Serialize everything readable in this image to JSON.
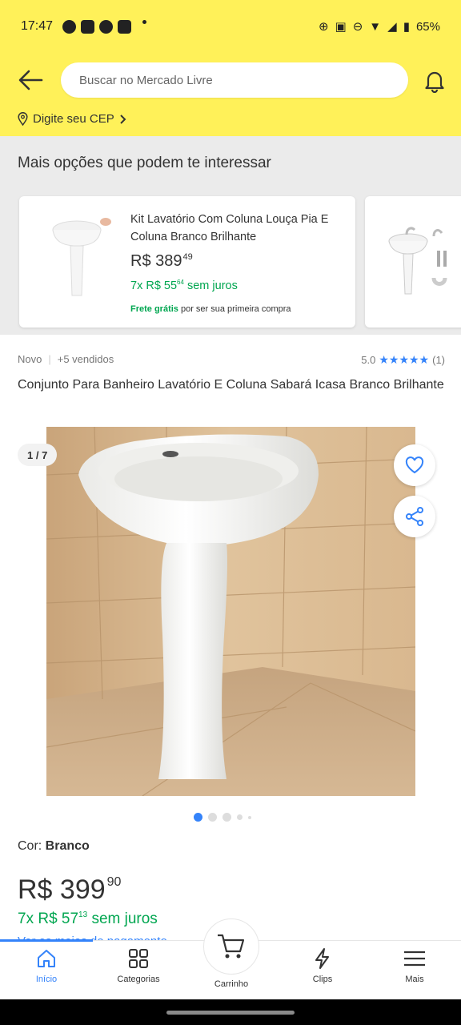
{
  "status_bar": {
    "time": "17:47",
    "battery": "65%",
    "icons_left": [
      "messenger-icon",
      "app-icon",
      "app-icon",
      "app-icon"
    ],
    "icons_right": [
      "add-circle-icon",
      "nfc-icon",
      "dnd-icon",
      "wifi-icon",
      "signal-icon",
      "battery-icon"
    ]
  },
  "header": {
    "search_placeholder": "Buscar no Mercado Livre",
    "cep_label": "Digite seu CEP",
    "brand_color": "#fff159"
  },
  "more_options": {
    "title": "Mais opções que podem te interessar",
    "card": {
      "title": "Kit Lavatório Com Coluna Louça Pia E Coluna Branco Brilhante",
      "price_int": "R$ 389",
      "price_cents": "49",
      "installments_prefix": "7x R$ 55",
      "installments_cents": "64",
      "installments_suffix": " sem juros",
      "shipping_bold": "Frete grátis",
      "shipping_rest": " por ser sua primeira compra"
    }
  },
  "product": {
    "condition": "Novo",
    "sold": "+5 vendidos",
    "rating_value": "5.0",
    "rating_count": "(1)",
    "stars": 5,
    "title": "Conjunto Para Banheiro Lavatório E Coluna Sabará  Icasa Branco Brilhante",
    "image_counter": "1 / 7",
    "color_label": "Cor: ",
    "color_value": "Branco",
    "price_int": "R$ 399",
    "price_cents": "90",
    "installments_prefix": "7x R$ 57",
    "installments_cents": "13",
    "installments_suffix": " sem juros",
    "payment_link": "Ver os meios de pagamento",
    "accent_color": "#3483fa",
    "green_color": "#00a650"
  },
  "bottom_nav": {
    "items": [
      {
        "label": "Início",
        "icon": "home-icon"
      },
      {
        "label": "Categorias",
        "icon": "grid-icon"
      },
      {
        "label": "Carrinho",
        "icon": "cart-icon"
      },
      {
        "label": "Clips",
        "icon": "bolt-icon"
      },
      {
        "label": "Mais",
        "icon": "menu-icon"
      }
    ]
  }
}
